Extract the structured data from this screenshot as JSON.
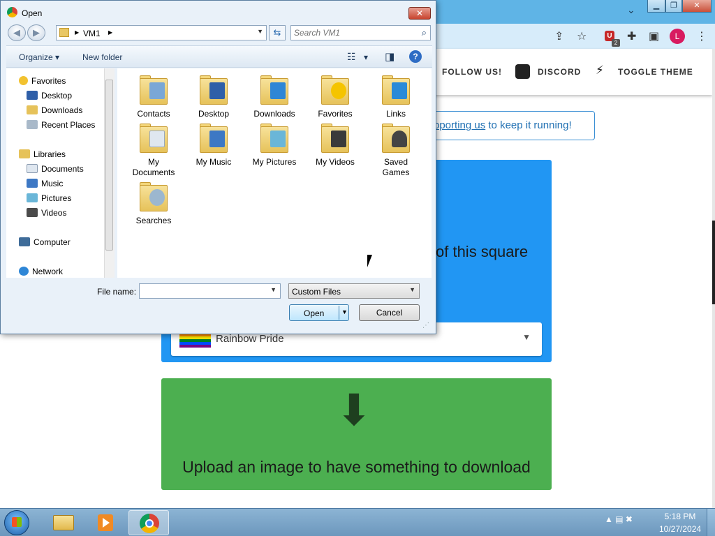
{
  "chrome": {
    "window_controls": {
      "minimize": "▁",
      "maximize": "❐",
      "close": "✕"
    },
    "tabs_dropdown_icon": "⌄",
    "toolbar_icons": {
      "share": "⇪",
      "star": "☆",
      "ext_badge": "U",
      "ext_badge_count": "2",
      "puzzle": "✚",
      "sidepanel": "▣",
      "menu": "⋮"
    },
    "profile_initial": "L"
  },
  "site": {
    "nav": {
      "follow": "FOLLOW US!",
      "discord": "DISCORD",
      "theme": "TOGGLE THEME"
    },
    "banner": {
      "link_text": "pporting us",
      "rest_text": " to keep it running!"
    },
    "blue_card_text": "of this square",
    "flag_select": {
      "selected": "Rainbow Pride",
      "caret": "▼"
    },
    "download_arrow": "⬇",
    "download_text": "Upload an image to have something to download"
  },
  "dialog": {
    "title": "Open",
    "close_glyph": "✕",
    "back_glyph": "◀",
    "forward_glyph": "▶",
    "breadcrumb": "VM1",
    "address_dropdown": "▼",
    "refresh_glyph": "⇆",
    "search_placeholder": "Search VM1",
    "search_glyph": "⌕",
    "organize": "Organize ▾",
    "new_folder": "New folder",
    "view_glyph": "☷",
    "view_drop": "▾",
    "preview_glyph": "◨",
    "help_glyph": "?",
    "nav_pane": {
      "favorites": {
        "label": "Favorites",
        "items": [
          "Desktop",
          "Downloads",
          "Recent Places"
        ]
      },
      "libraries": {
        "label": "Libraries",
        "items": [
          "Documents",
          "Music",
          "Pictures",
          "Videos"
        ]
      },
      "computer": "Computer",
      "network": "Network"
    },
    "folders": [
      {
        "label": "Contacts",
        "color": "#7aa7d6"
      },
      {
        "label": "Desktop",
        "color": "#2f5fa8"
      },
      {
        "label": "Downloads",
        "color": "#2e86d6"
      },
      {
        "label": "Favorites",
        "color": "#f5c400"
      },
      {
        "label": "Links",
        "color": "#2a8ad8"
      },
      {
        "label": "My Documents",
        "color": "#dfe7f0"
      },
      {
        "label": "My Music",
        "color": "#3d78c4"
      },
      {
        "label": "My Pictures",
        "color": "#6ab6d8"
      },
      {
        "label": "My Videos",
        "color": "#3a3a3a"
      },
      {
        "label": "Saved Games",
        "color": "#444444"
      },
      {
        "label": "Searches",
        "color": "#9cb7cf"
      }
    ],
    "file_name_label": "File name:",
    "file_name_value": "",
    "file_name_drop": "▼",
    "file_type": "Custom Files",
    "file_type_drop": "▼",
    "open_button": "Open",
    "open_drop": "▼",
    "cancel_button": "Cancel",
    "resize_grip": "⋰"
  },
  "taskbar": {
    "tray_icons": "▲  ▤  ✖",
    "time": "5:18 PM",
    "date": "10/27/2024"
  }
}
